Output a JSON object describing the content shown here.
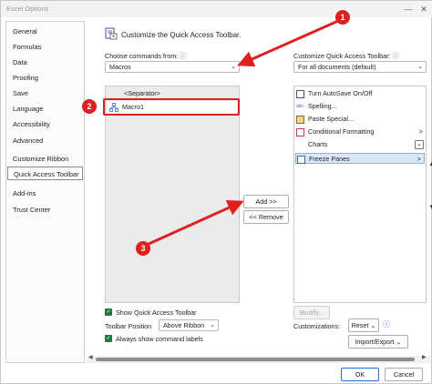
{
  "window": {
    "title": "Excel Options",
    "minimize": "—",
    "close": "✕"
  },
  "sidebar": {
    "items": [
      {
        "label": "General"
      },
      {
        "label": "Formulas"
      },
      {
        "label": "Data"
      },
      {
        "label": "Proofing"
      },
      {
        "label": "Save"
      },
      {
        "label": "Language"
      },
      {
        "label": "Accessibility"
      },
      {
        "label": "Advanced"
      },
      {
        "label": "Customize Ribbon"
      },
      {
        "label": "Quick Access Toolbar"
      },
      {
        "label": "Add-ins"
      },
      {
        "label": "Trust Center"
      }
    ],
    "selected": "Quick Access Toolbar"
  },
  "header": {
    "title": "Customize the Quick Access Toolbar."
  },
  "left": {
    "choose_label": "Choose commands from:",
    "info": "ⓘ",
    "combo_value": "Macros",
    "list": {
      "separator": "<Separator>",
      "macro": "Macro1"
    }
  },
  "right": {
    "customize_label": "Customize Quick Access Toolbar:",
    "info": "ⓘ",
    "combo_value": "For all documents (default)",
    "list": [
      {
        "label": "Turn AutoSave On/Off",
        "icon": "autosave-icon"
      },
      {
        "label": "Spelling...",
        "icon": "spelling-icon"
      },
      {
        "label": "Paste Special...",
        "icon": "paste-icon"
      },
      {
        "label": "Conditional Formatting",
        "icon": "conditional-formatting-icon",
        "arrow": ">"
      },
      {
        "label": "Charts",
        "icon": "",
        "arrow": "⌄"
      },
      {
        "label": "Freeze Panes",
        "icon": "freeze-panes-icon",
        "arrow": ">"
      }
    ]
  },
  "buttons": {
    "add": "Add >>",
    "remove": "<< Remove",
    "modify": "Modify...",
    "reset": "Reset",
    "import_export": "Import/Export",
    "ok": "OK",
    "cancel": "Cancel"
  },
  "options": {
    "show_qat": "Show Quick Access Toolbar",
    "position_label": "Toolbar Position",
    "position_value": "Above Ribbon",
    "always_show": "Always show command labels",
    "customizations_label": "Customizations:"
  },
  "callouts": [
    "1",
    "2",
    "3"
  ],
  "colors": {
    "accent_red": "#e02020",
    "check_green": "#1a7d3c",
    "selection_blue": "#dbe8f7"
  }
}
